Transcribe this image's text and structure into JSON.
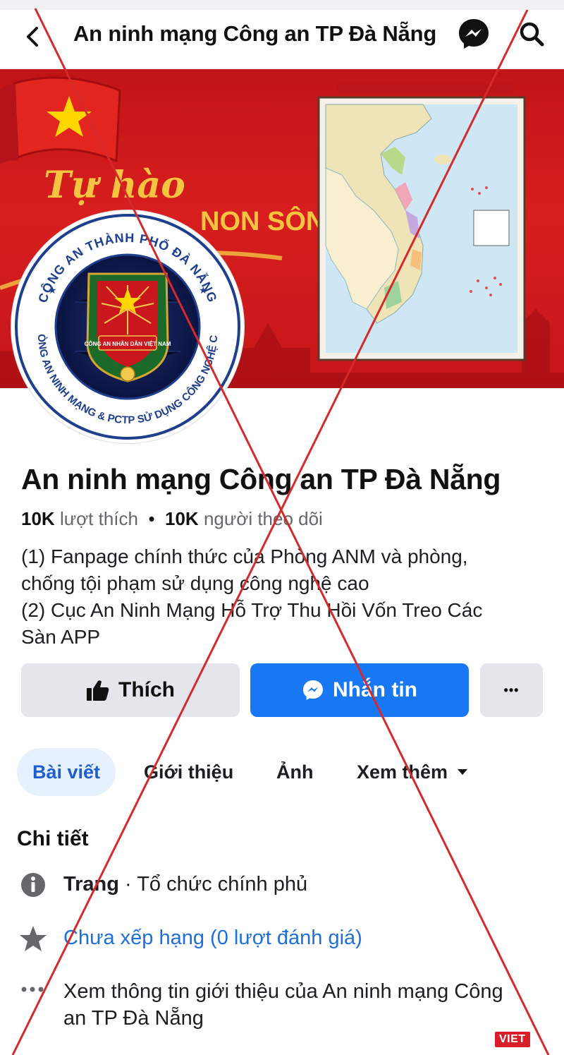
{
  "header": {
    "title": "An ninh mạng Công an TP Đà Nẵng"
  },
  "cover": {
    "banner_line1": "Tự hào",
    "banner_line2": "NON SÔNG"
  },
  "avatar": {
    "ring_top": "CÔNG AN THÀNH PHỐ ĐÀ NẴNG",
    "ring_bottom": "PHÒNG AN NINH MẠNG & PCTP SỬ DỤNG CÔNG NGHỆ CAO",
    "badge_text": "CÔNG AN NHÂN DÂN VIỆT NAM"
  },
  "page": {
    "name": "An ninh mạng Công an TP Đà Nẵng",
    "likes_count": "10K",
    "likes_label": "lượt thích",
    "separator": "•",
    "followers_count": "10K",
    "followers_label": "người theo dõi",
    "bio_lines": [
      "(1) Fanpage chính thức của Phòng ANM và phòng,",
      "chống tội phạm sử dụng công nghệ cao",
      "(2) Cục An Ninh Mạng Hỗ Trợ Thu Hồi Vốn Treo Các",
      "Sàn APP"
    ]
  },
  "actions": {
    "like_label": "Thích",
    "message_label": "Nhắn tin",
    "more_label": "•••"
  },
  "tabs": [
    {
      "label": "Bài viết",
      "active": true
    },
    {
      "label": "Giới thiệu"
    },
    {
      "label": "Ảnh"
    },
    {
      "label": "Xem thêm"
    }
  ],
  "details": {
    "title": "Chi tiết",
    "type_bold": "Trang",
    "type_rest": " · Tổ chức chính phủ",
    "rating": "Chưa xếp hạng (0 lượt đánh giá)",
    "more_info_lines": [
      "Xem thông tin giới thiệu của An ninh mạng Công",
      "an TP Đà Nẵng"
    ]
  },
  "watermark": "VIET",
  "colors": {
    "facebook_blue": "#1877f2",
    "cover_red": "#d81e1e",
    "cross_red": "#d42a2a"
  }
}
